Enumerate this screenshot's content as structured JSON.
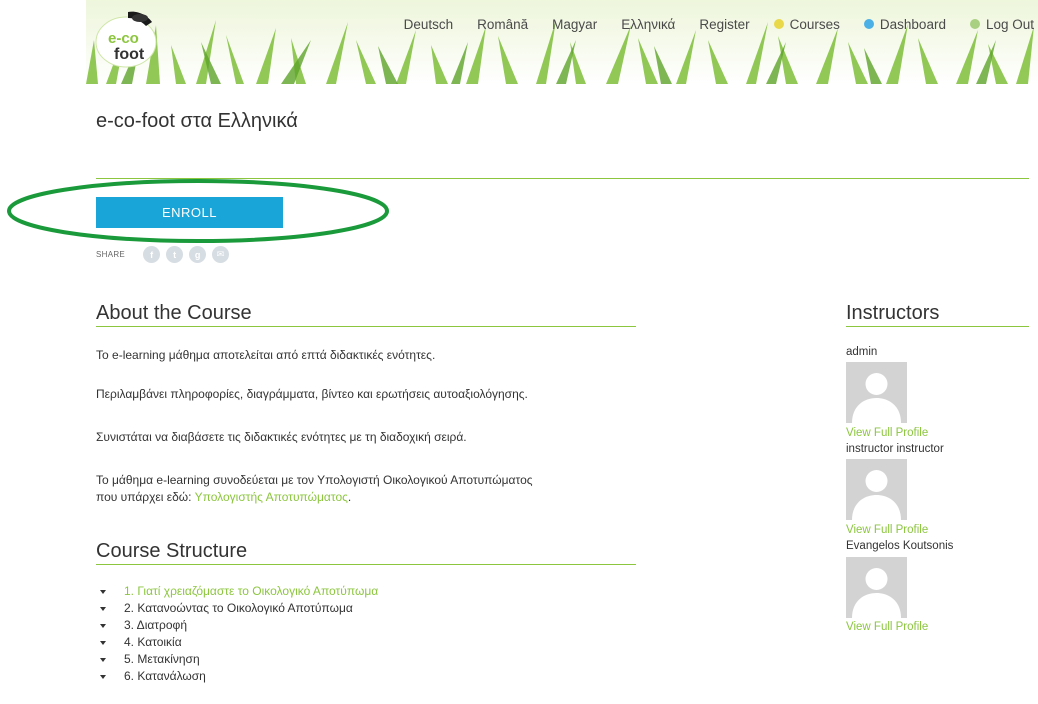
{
  "header": {
    "logo_text_1": "e-co",
    "logo_text_2": "foot",
    "nav": [
      {
        "label": "Deutsch",
        "icon": null
      },
      {
        "label": "Română",
        "icon": null
      },
      {
        "label": "Magyar",
        "icon": null
      },
      {
        "label": "Ελληνικά",
        "icon": null
      },
      {
        "label": "Register",
        "icon": null
      },
      {
        "label": "Courses",
        "icon": "courses-icon"
      },
      {
        "label": "Dashboard",
        "icon": "dashboard-icon"
      },
      {
        "label": "Log Out",
        "icon": "user-icon"
      }
    ]
  },
  "page": {
    "title": "e-co-foot στα Ελληνικά",
    "enroll_label": "ENROLL",
    "share_label": "SHARE"
  },
  "about": {
    "heading": "About the Course",
    "para1": "Το e-learning μάθημα αποτελείται από επτά διδακτικές ενότητες.",
    "para2": "Περιλαμβάνει πληροφορίες, διαγράμματα, βίντεο και ερωτήσεις αυτοαξιολόγησης.",
    "para3": "Συνιστάται να διαβάσετε τις διδακτικές ενότητες με τη διαδοχική σειρά.",
    "para4_line1": "Το μάθημα e-learning συνοδεύεται με τον Υπολογιστή Οικολογικού Αποτυπώματος",
    "para4_line2": "που υπάρχει εδώ: ",
    "para4_link": "Υπολογιστής Αποτυπώματος",
    "para4_end": "."
  },
  "structure": {
    "heading": "Course Structure",
    "items": [
      "1. Γιατί χρειαζόμαστε το Οικολογικό Αποτύπωμα",
      "2. Κατανοώντας το Οικολογικό Αποτύπωμα",
      "3. Διατροφή",
      "4. Κατοικία",
      "5. Μετακίνηση",
      "6. Κατανάλωση"
    ]
  },
  "instructors": {
    "heading": "Instructors",
    "people": [
      {
        "name": "admin",
        "link": "View Full Profile"
      },
      {
        "name": "instructor instructor",
        "link": "View Full Profile"
      },
      {
        "name": "Evangelos Koutsonis",
        "link": "View Full Profile"
      }
    ]
  },
  "colors": {
    "accent_green": "#8cc63f",
    "enroll_blue": "#1aa5d8",
    "annotation_green": "#1a9a3a"
  }
}
